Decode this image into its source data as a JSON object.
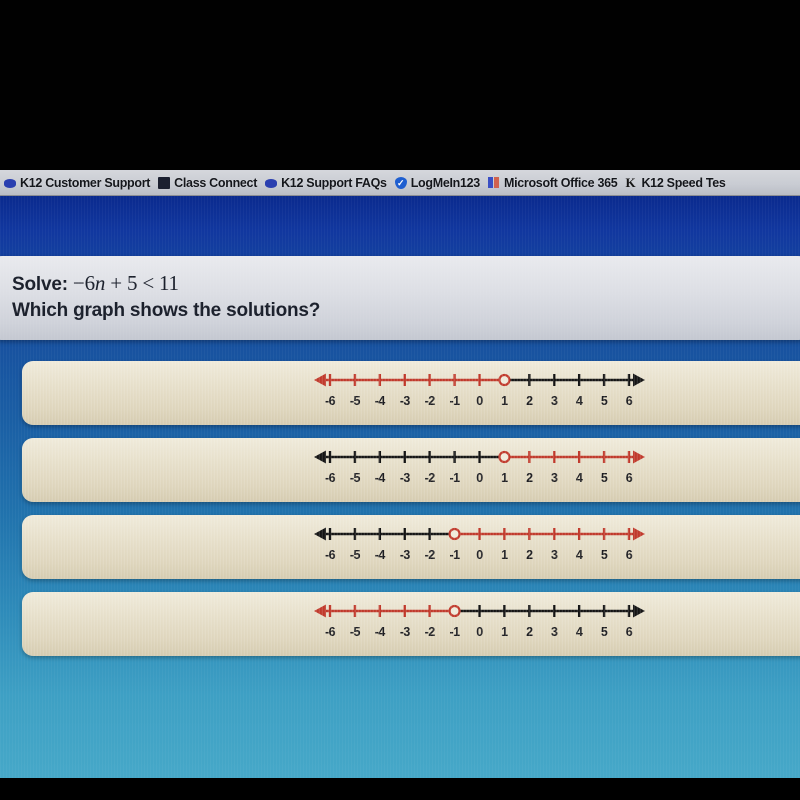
{
  "browser": {
    "bookmarks": [
      {
        "label": "K12 Customer Support",
        "icon": "ellipse-blue-icon"
      },
      {
        "label": "Class Connect",
        "icon": "dark-square-icon"
      },
      {
        "label": "K12 Support FAQs",
        "icon": "ellipse-blue-icon"
      },
      {
        "label": "LogMeIn123",
        "icon": "shield-icon"
      },
      {
        "label": "Microsoft Office 365",
        "icon": "office-squares-icon"
      },
      {
        "label": "K12 Speed Tes",
        "icon": "letter-k-icon"
      }
    ]
  },
  "question": {
    "prompt_prefix": "Solve:",
    "expression": "−6n + 5 < 11",
    "expression_parts": {
      "neg_coeff": "−6",
      "variable": "n",
      "plus": "+ 5",
      "relation": "< 11"
    },
    "sub_prompt": "Which graph shows the solutions?"
  },
  "colors": {
    "highlight_red": "#c0392b",
    "line_black": "#141414",
    "card_cream": "#e7e0cb",
    "banner_gray": "#dcdee4",
    "page_blue_top": "#0a2a8e",
    "page_blue_bottom": "#46a8c8"
  },
  "chart_data": [
    {
      "type": "line",
      "id": "option-a",
      "title": "Option A number line",
      "xlabel": "",
      "ylabel": "",
      "tick_labels": [
        "-6",
        "-5",
        "-4",
        "-3",
        "-2",
        "-1",
        "0",
        "1",
        "2",
        "3",
        "4",
        "5",
        "6"
      ],
      "xlim": [
        -6,
        6
      ],
      "grid": false,
      "open_circle_at": 1,
      "circle_style": "open",
      "highlight_direction": "left",
      "highlight_color": "#c0392b",
      "base_color": "#141414",
      "left_arrow": true,
      "right_arrow": true,
      "left_arrow_color": "#c0392b",
      "right_arrow_color": "#141414",
      "description": "Red ray extending left from an open circle at 1; black segment to the right."
    },
    {
      "type": "line",
      "id": "option-b",
      "title": "Option B number line",
      "xlabel": "",
      "ylabel": "",
      "tick_labels": [
        "-6",
        "-5",
        "-4",
        "-3",
        "-2",
        "-1",
        "0",
        "1",
        "2",
        "3",
        "4",
        "5",
        "6"
      ],
      "xlim": [
        -6,
        6
      ],
      "grid": false,
      "open_circle_at": 1,
      "circle_style": "open",
      "highlight_direction": "right",
      "highlight_color": "#c0392b",
      "base_color": "#141414",
      "left_arrow": true,
      "right_arrow": true,
      "left_arrow_color": "#141414",
      "right_arrow_color": "#c0392b",
      "description": "Black segment left of an open circle at 1; red ray extending right."
    },
    {
      "type": "line",
      "id": "option-c",
      "title": "Option C number line",
      "xlabel": "",
      "ylabel": "",
      "tick_labels": [
        "-6",
        "-5",
        "-4",
        "-3",
        "-2",
        "-1",
        "0",
        "1",
        "2",
        "3",
        "4",
        "5",
        "6"
      ],
      "xlim": [
        -6,
        6
      ],
      "grid": false,
      "open_circle_at": -1,
      "circle_style": "open",
      "highlight_direction": "right",
      "highlight_color": "#c0392b",
      "base_color": "#141414",
      "left_arrow": true,
      "right_arrow": true,
      "left_arrow_color": "#141414",
      "right_arrow_color": "#c0392b",
      "description": "Black segment left of an open circle at -1; red ray extending right."
    },
    {
      "type": "line",
      "id": "option-d",
      "title": "Option D number line",
      "xlabel": "",
      "ylabel": "",
      "tick_labels": [
        "-6",
        "-5",
        "-4",
        "-3",
        "-2",
        "-1",
        "0",
        "1",
        "2",
        "3",
        "4",
        "5",
        "6"
      ],
      "xlim": [
        -6,
        6
      ],
      "grid": false,
      "open_circle_at": -1,
      "circle_style": "open",
      "highlight_direction": "left",
      "highlight_color": "#c0392b",
      "base_color": "#141414",
      "left_arrow": true,
      "right_arrow": true,
      "left_arrow_color": "#c0392b",
      "right_arrow_color": "#141414",
      "description": "Red ray extending left from an open circle at -1; black segment to the right."
    }
  ]
}
